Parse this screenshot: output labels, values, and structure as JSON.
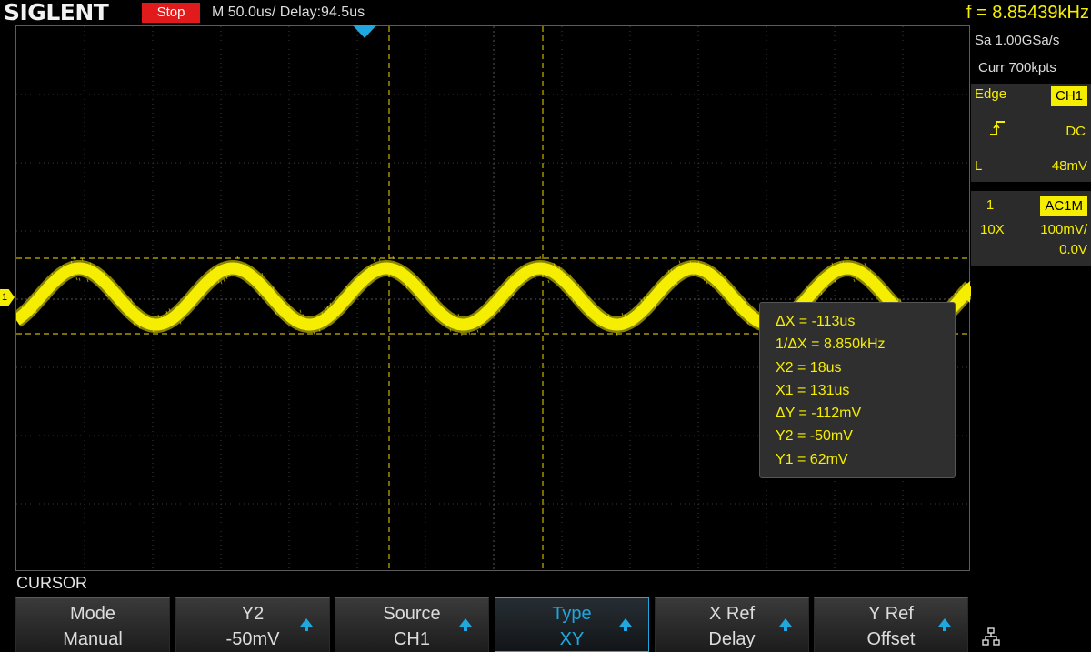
{
  "header": {
    "brand": "SIGLENT",
    "run_state": "Stop",
    "timebase": "M 50.0us/  Delay:94.5us",
    "frequency": "f = 8.85439kHz"
  },
  "acquisition": {
    "sample_rate": "Sa 1.00GSa/s",
    "memory_depth": "Curr 700kpts"
  },
  "trigger": {
    "type": "Edge",
    "source": "CH1",
    "slope_icon": "rising-edge-icon",
    "coupling": "DC",
    "level_label": "L",
    "level": "48mV"
  },
  "channel": {
    "number": "1",
    "coupling": "AC1M",
    "probe": "10X",
    "scale": "100mV/",
    "offset": "0.0V",
    "marker_label": "1"
  },
  "cursor_readout": [
    "ΔX = -113us",
    "1/ΔX = 8.850kHz",
    "X2 = 18us",
    "X1 = 131us",
    "ΔY = -112mV",
    "Y2 = -50mV",
    "Y1 = 62mV"
  ],
  "menu": {
    "title": "CURSOR",
    "softkeys": [
      {
        "label": "Mode",
        "value": "Manual",
        "has_arrow": false,
        "active": false
      },
      {
        "label": "Y2",
        "value": "-50mV",
        "has_arrow": true,
        "active": false
      },
      {
        "label": "Source",
        "value": "CH1",
        "has_arrow": true,
        "active": false
      },
      {
        "label": "Type",
        "value": "XY",
        "has_arrow": true,
        "active": true
      },
      {
        "label": "X Ref",
        "value": "Delay",
        "has_arrow": true,
        "active": false
      },
      {
        "label": "Y Ref",
        "value": "Offset",
        "has_arrow": true,
        "active": false
      }
    ],
    "extra_icon": "network-icon"
  },
  "colors": {
    "trace": "#f5ee00",
    "cursor": "#c8b400",
    "accent": "#1fa7e0",
    "stop": "#e11b1b",
    "grid": "#4a4a4a"
  }
}
